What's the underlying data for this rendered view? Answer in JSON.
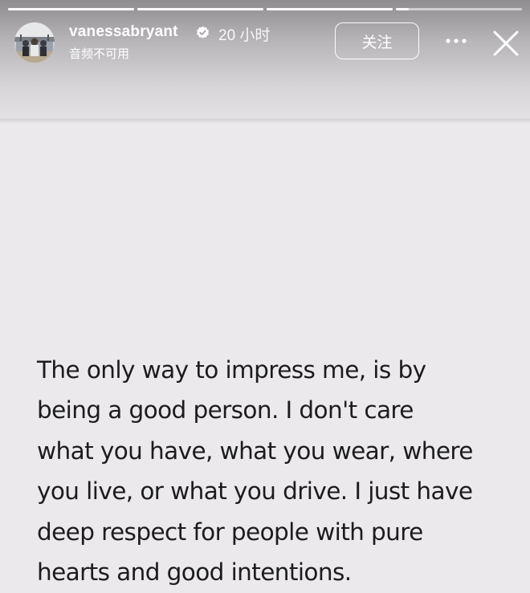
{
  "story": {
    "progress": [
      1,
      1,
      1,
      0.1
    ],
    "header": {
      "username": "vanessabryant",
      "verified_icon": "verified-badge-icon",
      "time_ago": "20 小时",
      "audio_status": "音频不可用",
      "follow_label": "关注",
      "more_icon": "more-options-icon",
      "close_icon": "close-icon"
    },
    "text_lines": [
      "The only way to impress me, is by",
      "being a good person. I don't care",
      "what you have, what you wear, where",
      "you live, or what you drive. I just have",
      "deep respect for people with pure",
      "hearts and good intentions."
    ]
  }
}
